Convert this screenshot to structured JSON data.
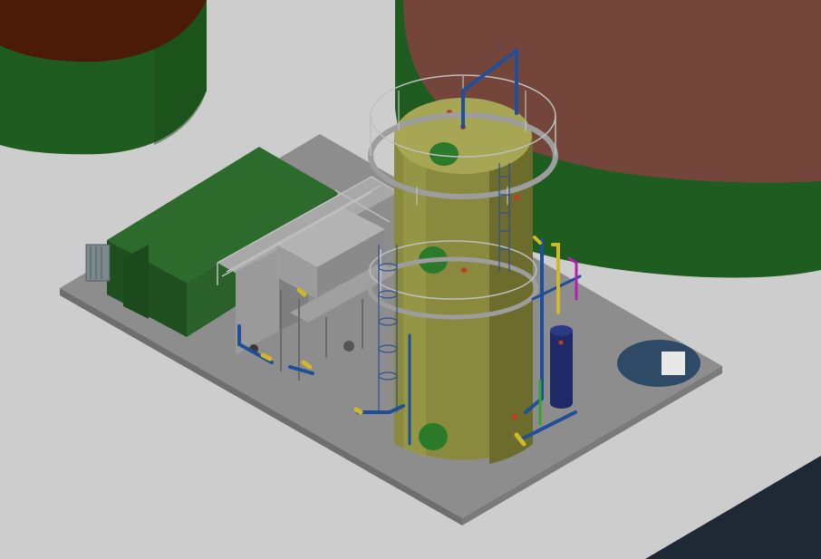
{
  "viewport": {
    "kind": "3d-cad-model-view",
    "labels": [],
    "colors": {
      "ground": "#cdcdcd",
      "dark_corner": "#1f2935",
      "pad": "#8d8d8d",
      "pad_edge": "#6e6e6e",
      "tank_left_green": "#1f5c1f",
      "tank_left_top": "#4b1a09",
      "tank_right_green": "#1f5c1f",
      "tank_right_top": "#74463b",
      "column_body": "#8a8a3e",
      "column_shade": "#6c6c2c",
      "column_highlight": "#a6a655",
      "manhole": "#2a7a2a",
      "building_green": "#2d6b2d",
      "building_dark": "#1f4f1f",
      "equipment_gray": "#9a9a9a",
      "pipe_blue": "#1f4f99",
      "pipe_yellow": "#d1b82a",
      "pipe_magenta": "#b21fb2",
      "pipe_green": "#33a633",
      "vessel_navy": "#1e2a66",
      "sump_blue": "#2e4a66",
      "railing": "#bfbfbf",
      "nozzle_red": "#c43a2a"
    }
  }
}
